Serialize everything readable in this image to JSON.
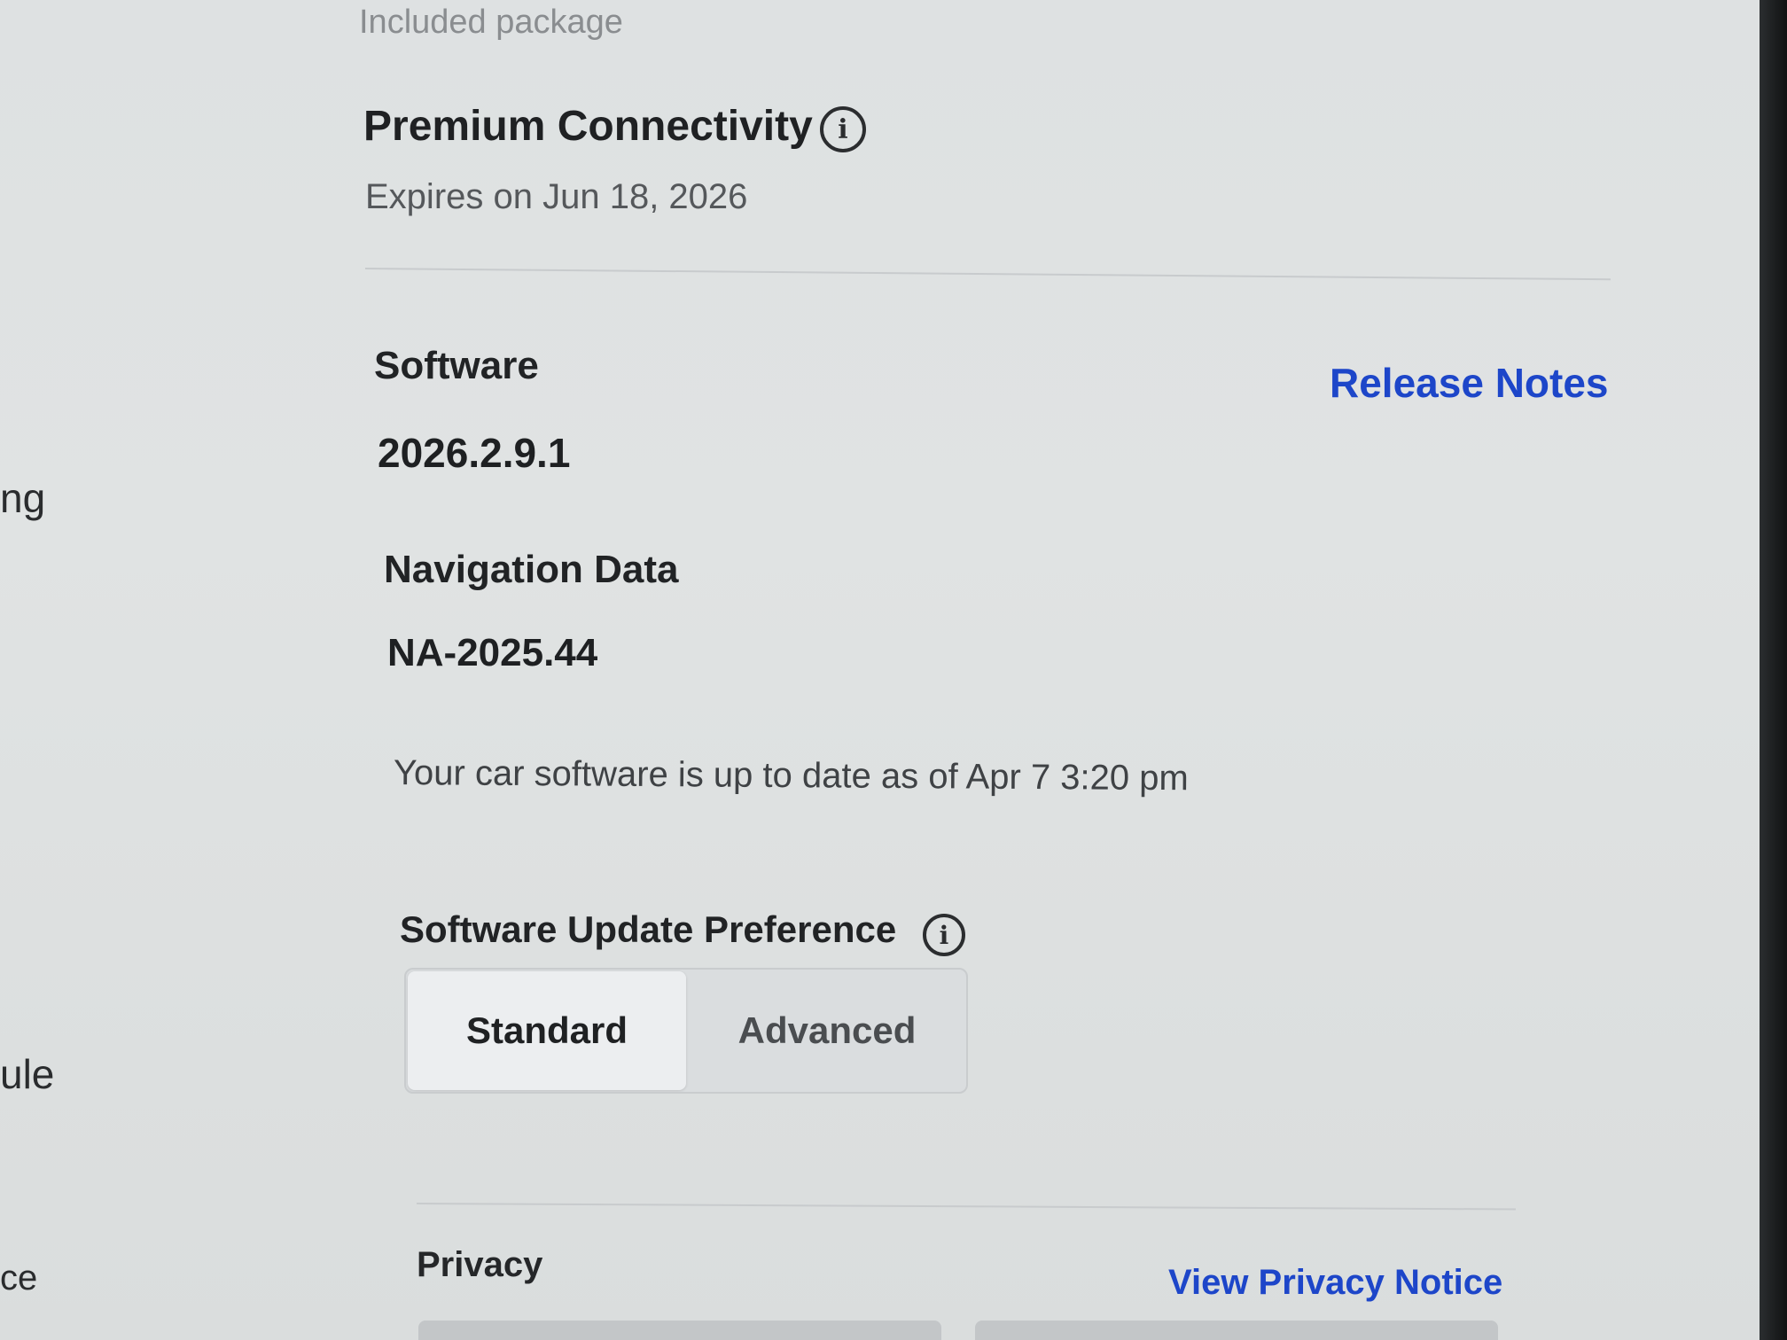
{
  "sidebar_fragments": [
    "ng",
    "ule",
    "ce"
  ],
  "connectivity": {
    "section_label": "Included package",
    "title": "Premium Connectivity",
    "info_icon": "info-icon",
    "expires": "Expires on Jun 18, 2026"
  },
  "software": {
    "label": "Software",
    "version": "2026.2.9.1",
    "release_notes_link": "Release Notes",
    "navigation_label": "Navigation Data",
    "navigation_version": "NA-2025.44",
    "status": "Your car software is up to date as of Apr 7 3:20 pm"
  },
  "update_preference": {
    "label": "Software Update Preference",
    "info_icon": "info-icon",
    "options": [
      "Standard",
      "Advanced"
    ],
    "selected": "Standard"
  },
  "privacy": {
    "label": "Privacy",
    "link": "View Privacy Notice"
  },
  "colors": {
    "link_blue": "#1d46c9",
    "background": "#dee1e2",
    "selected_segment": "#eceef0"
  }
}
